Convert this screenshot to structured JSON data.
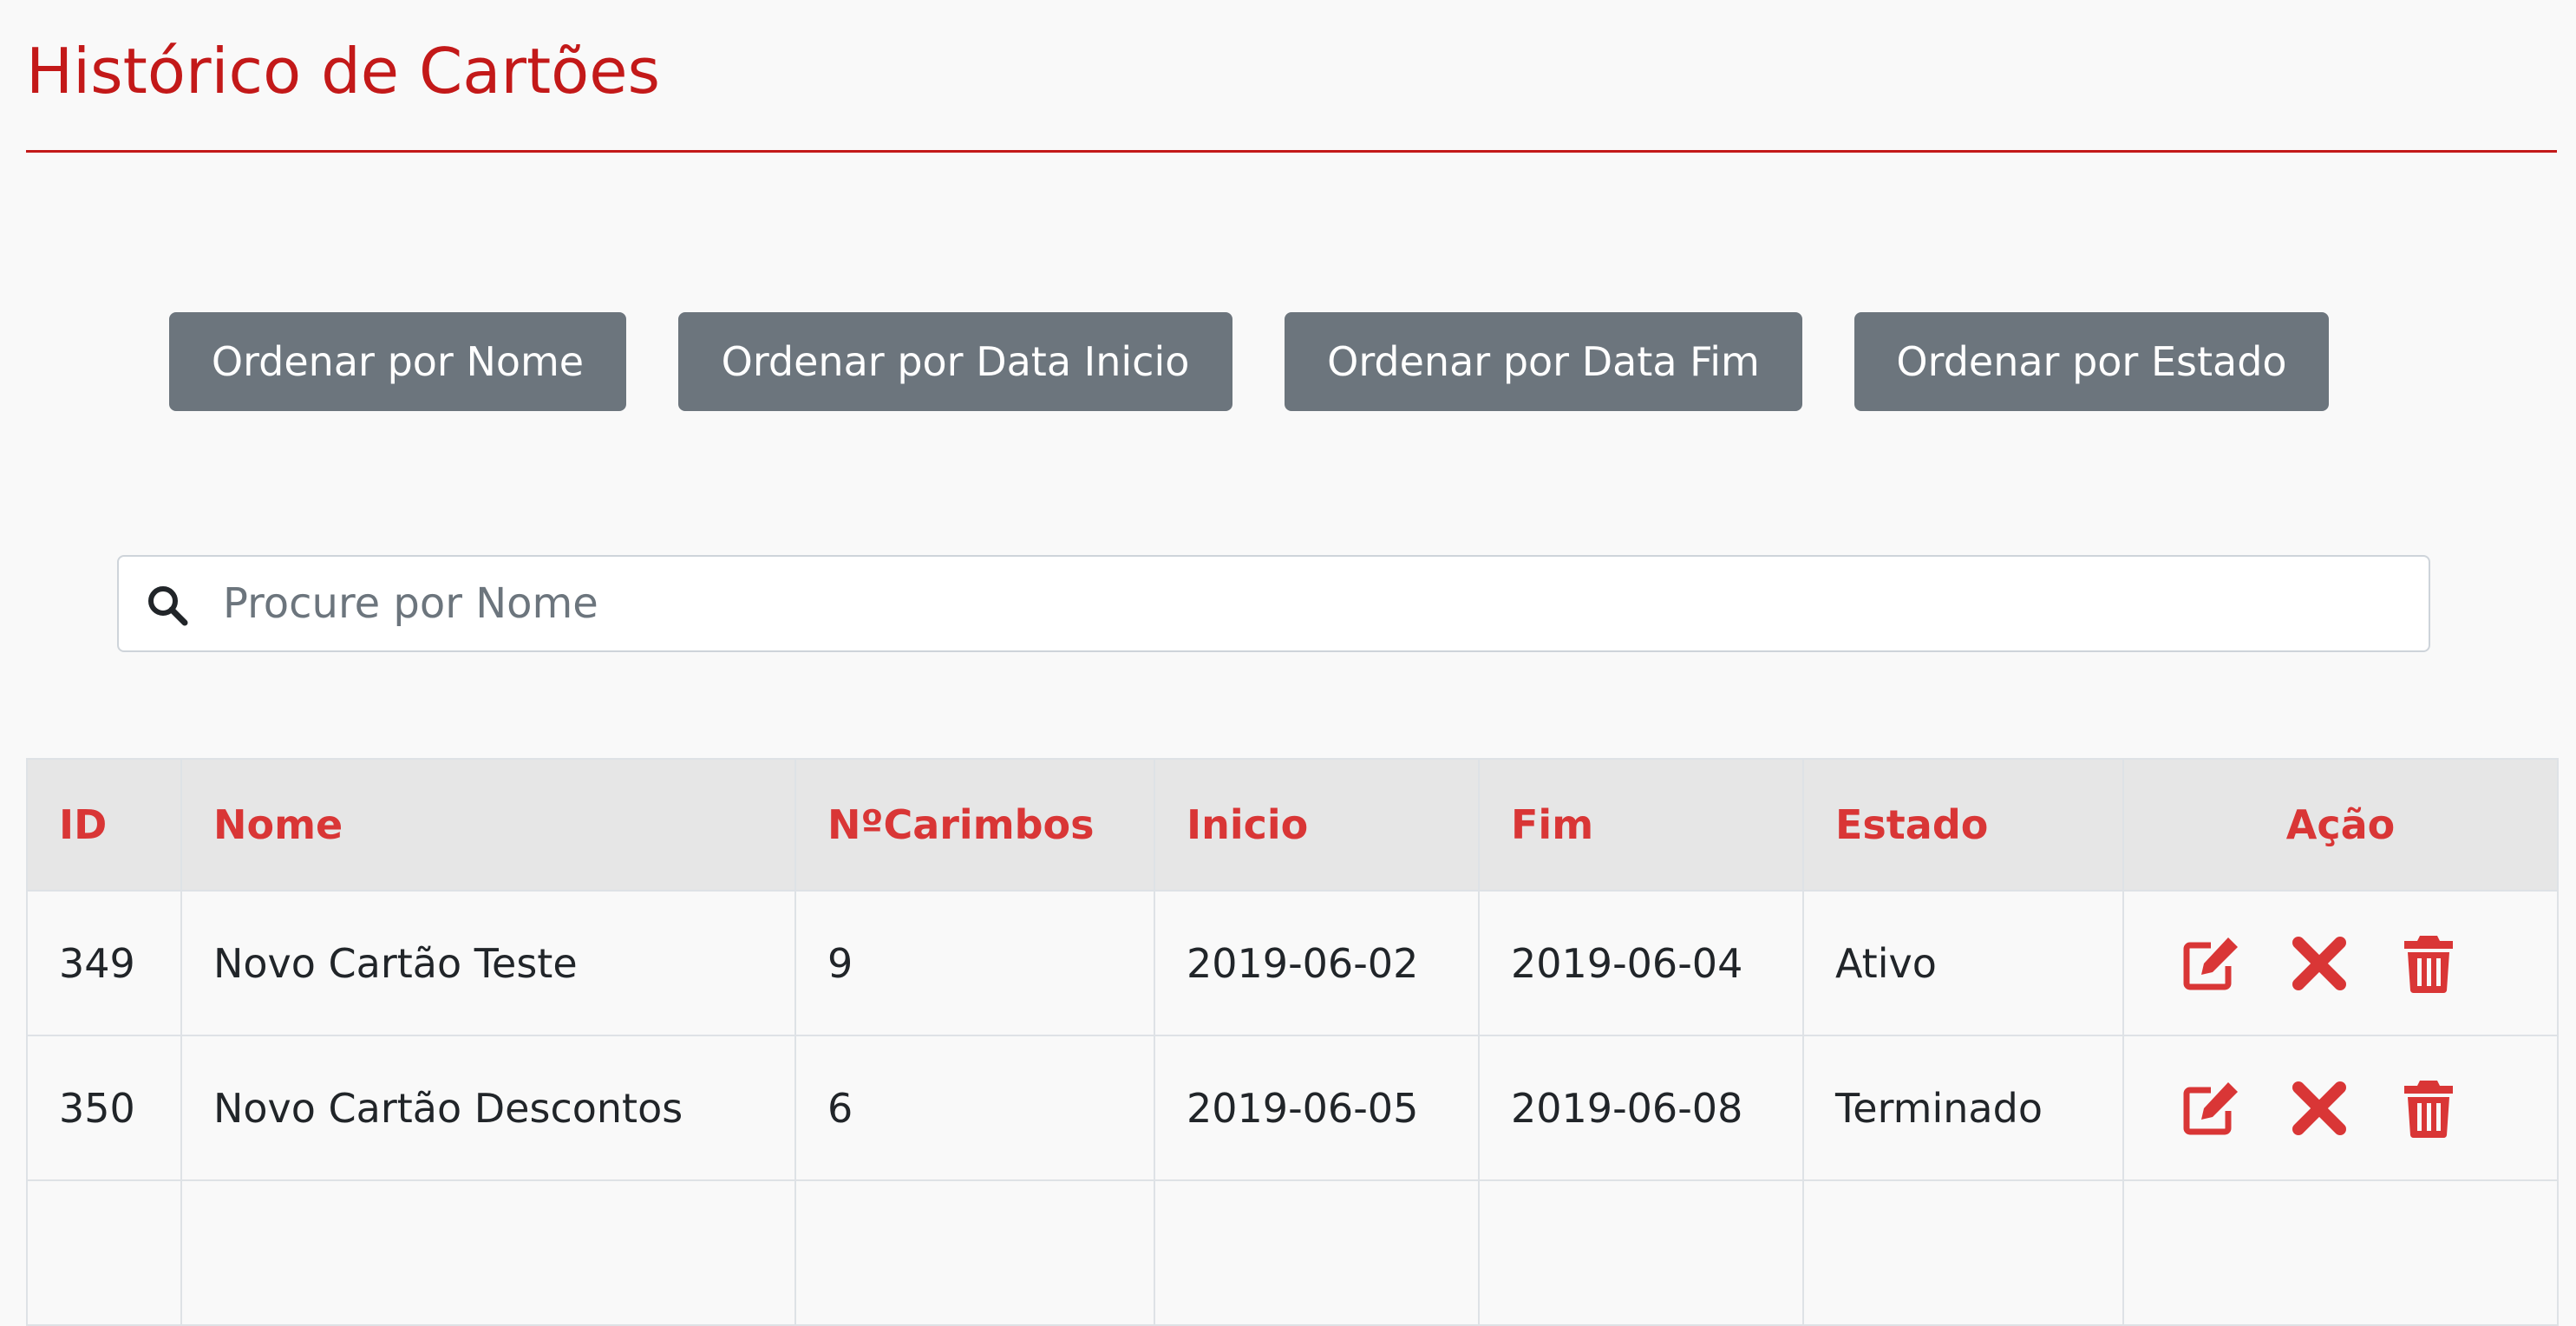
{
  "page": {
    "title": "Histórico de Cartões"
  },
  "sort_buttons": [
    {
      "label": "Ordenar por Nome"
    },
    {
      "label": "Ordenar por Data Inicio"
    },
    {
      "label": "Ordenar por Data Fim"
    },
    {
      "label": "Ordenar por Estado"
    }
  ],
  "search": {
    "placeholder": "Procure por Nome",
    "value": "",
    "icon": "search-icon"
  },
  "table": {
    "headers": {
      "id": "ID",
      "nome": "Nome",
      "carimbos": "NºCarimbos",
      "inicio": "Inicio",
      "fim": "Fim",
      "estado": "Estado",
      "acao": "Ação"
    },
    "rows": [
      {
        "id": "349",
        "nome": "Novo Cartão Teste",
        "carimbos": "9",
        "inicio": "2019-06-02",
        "fim": "2019-06-04",
        "estado": "Ativo"
      },
      {
        "id": "350",
        "nome": "Novo Cartão Descontos",
        "carimbos": "6",
        "inicio": "2019-06-05",
        "fim": "2019-06-08",
        "estado": "Terminado"
      },
      {
        "id": "",
        "nome": "",
        "carimbos": "",
        "inicio": "",
        "fim": "",
        "estado": ""
      }
    ],
    "action_icons": [
      "edit-icon",
      "close-icon",
      "trash-icon"
    ]
  },
  "colors": {
    "accent": "#c31919",
    "header_text": "#d93636",
    "button_bg": "#6c757d",
    "background": "#f9f9f9"
  }
}
